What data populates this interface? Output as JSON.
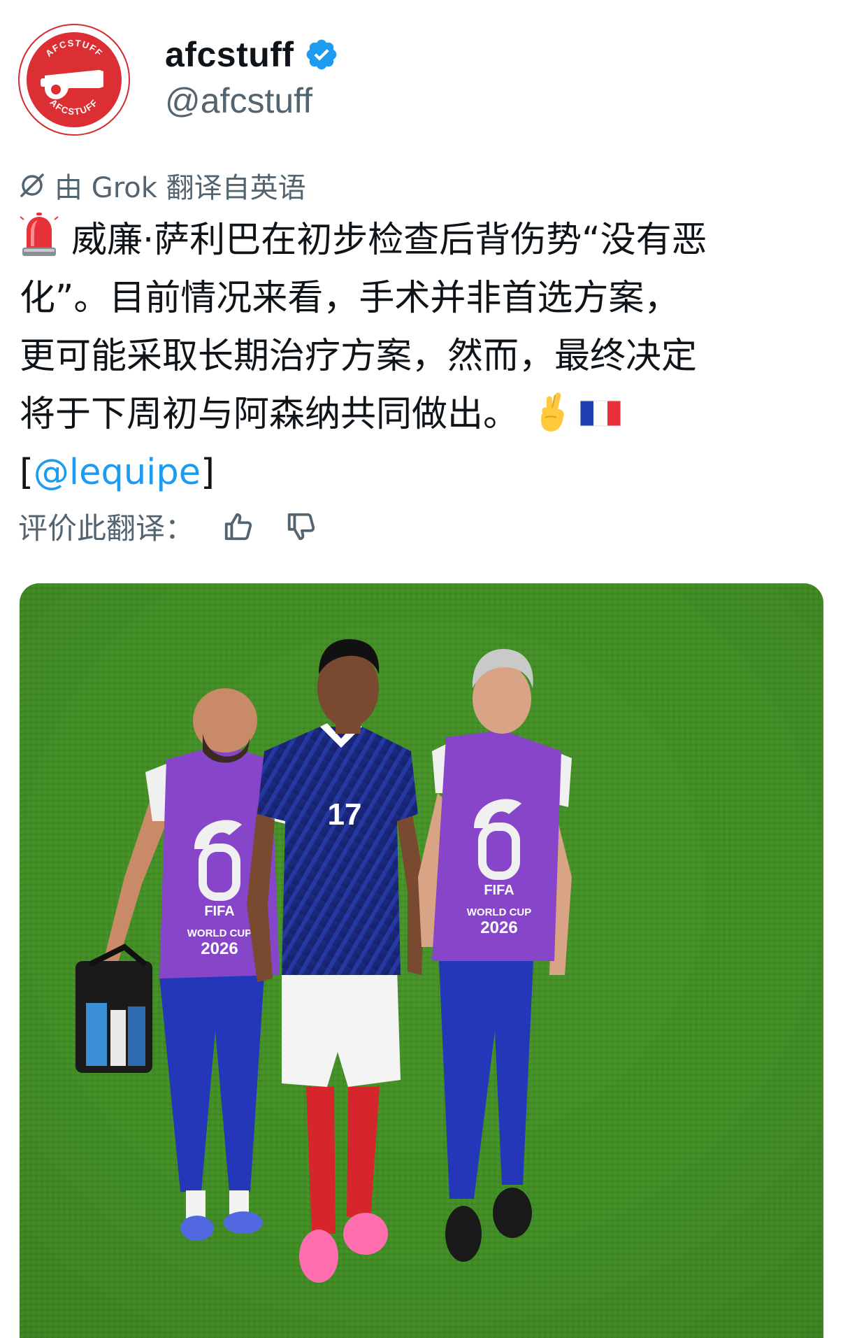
{
  "account": {
    "display_name": "afcstuff",
    "handle": "@afcstuff",
    "avatar_ring_text": "AFCSTUFF",
    "verified": true,
    "brand_color": "#db2f33",
    "verified_color": "#1d9bf0"
  },
  "translation_note": "由 Grok 翻译自英语",
  "tweet": {
    "lines": [
      "威廉·萨利巴在初步检查后背伤势“没有恶",
      "化”。目前情况来看，手术并非首选方案，",
      "更可能采取长期治疗方案，然而，最终决定",
      "将于下周初与阿森纳共同做出。"
    ],
    "mention_open": "[",
    "mention": "@lequipe",
    "mention_close": "]",
    "emojis": [
      "siren-emoji",
      "crossed-fingers-emoji",
      "france-flag-emoji"
    ]
  },
  "rate_translation": {
    "label": "评价此翻译：",
    "icons": [
      "thumbs-up-icon",
      "thumbs-down-icon"
    ]
  },
  "photo": {
    "description_icon": "football-match-photo",
    "jersey_number": "17",
    "bib_text_top": "FIFA",
    "bib_text_bottom": "WORLD CUP",
    "bib_year": "2026"
  }
}
